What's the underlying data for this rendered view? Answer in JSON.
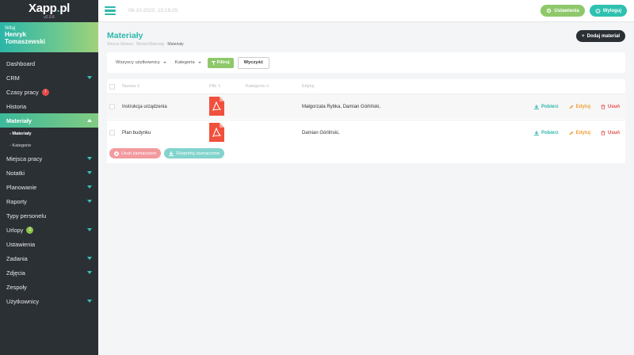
{
  "app": {
    "logo_main": "Xapp",
    "logo_dot": ".",
    "logo_suffix": "pl",
    "version": "v2.0.6"
  },
  "user": {
    "greeting": "Witaj",
    "first_name": "Henryk",
    "last_name": "Tomaszewski"
  },
  "sidebar": {
    "items": [
      {
        "label": "Dashboard"
      },
      {
        "label": "CRM"
      },
      {
        "label": "Czasy pracy",
        "badge": "!"
      },
      {
        "label": "Historia"
      },
      {
        "label": "Materiały"
      },
      {
        "label": "Miejsca pracy"
      },
      {
        "label": "Notatki"
      },
      {
        "label": "Planowanie"
      },
      {
        "label": "Raporty"
      },
      {
        "label": "Typy personelu"
      },
      {
        "label": "Urlopy",
        "badge": "1"
      },
      {
        "label": "Ustawienia"
      },
      {
        "label": "Zadania"
      },
      {
        "label": "Zdjęcia"
      },
      {
        "label": "Zespoły"
      },
      {
        "label": "Użytkownicy"
      }
    ],
    "sub_items": [
      {
        "label": "- Materiały"
      },
      {
        "label": "- Kategorie"
      }
    ]
  },
  "topbar": {
    "datetime": "06-10-2020, 15:19:25",
    "settings_label": "Ustawienia",
    "logout_label": "Wyloguj"
  },
  "page": {
    "title": "Materiały",
    "breadcrumb": [
      "Strona Główna",
      "Moduł Materiały",
      "Materiały"
    ],
    "add_button": "Dodaj materiał"
  },
  "filters": {
    "users_select": "Wszyscy użytkownicy",
    "category_select": "Kategoria",
    "filter_button": "Filtruj",
    "clear_button": "Wyczyść"
  },
  "table": {
    "headers": {
      "name": "Nazwa",
      "file": "Plik",
      "category": "Kategoria",
      "editors": "Edytuj"
    },
    "rows": [
      {
        "name": "Instrukcja urządzenia",
        "category": "",
        "editors": "Małgorzata Rybka, Damian Górliński,"
      },
      {
        "name": "Plan budynku",
        "category": "",
        "editors": "Damian Górliński,"
      }
    ],
    "actions": {
      "download": "Pobierz",
      "edit": "Edytuj",
      "delete": "Usuń"
    },
    "bulk": {
      "delete_selected": "Usuń zaznaczone",
      "export_selected": "Eksportuj zaznaczone"
    }
  },
  "colors": {
    "accent": "#2fb8ac",
    "green": "#8fc86a",
    "dark": "#2b3035",
    "danger": "#e84c4c",
    "warning": "#f0a033",
    "pdf": "#f0503c"
  }
}
